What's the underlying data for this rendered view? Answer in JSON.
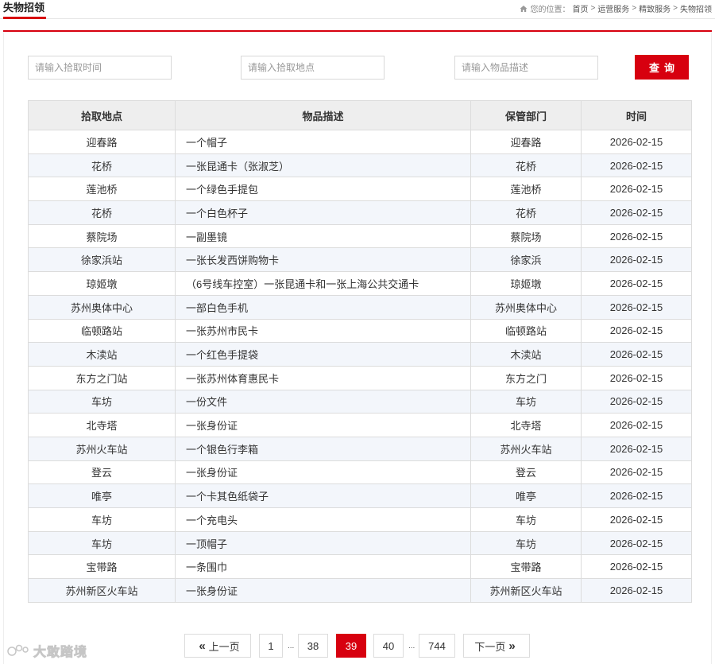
{
  "header": {
    "title": "失物招领",
    "breadcrumb": {
      "prefix": "您的位置：",
      "items": [
        "首页",
        "运营服务",
        "精致服务",
        "失物招领"
      ],
      "separator": ">"
    }
  },
  "search": {
    "time_placeholder": "请输入拾取时间",
    "location_placeholder": "请输入拾取地点",
    "desc_placeholder": "请输入物品描述",
    "button_label": "查询"
  },
  "table": {
    "headers": [
      "拾取地点",
      "物品描述",
      "保管部门",
      "时间"
    ],
    "rows": [
      [
        "迎春路",
        "一个帽子",
        "迎春路",
        "2026-02-15"
      ],
      [
        "花桥",
        "一张昆通卡（张淑芝）",
        "花桥",
        "2026-02-15"
      ],
      [
        "莲池桥",
        "一个绿色手提包",
        "莲池桥",
        "2026-02-15"
      ],
      [
        "花桥",
        "一个白色杯子",
        "花桥",
        "2026-02-15"
      ],
      [
        "蔡院场",
        "一副墨镜",
        "蔡院场",
        "2026-02-15"
      ],
      [
        "徐家浜站",
        "一张长发西饼购物卡",
        "徐家浜",
        "2026-02-15"
      ],
      [
        "琼姬墩",
        "（6号线车控室）一张昆通卡和一张上海公共交通卡",
        "琼姬墩",
        "2026-02-15"
      ],
      [
        "苏州奥体中心",
        "一部白色手机",
        "苏州奥体中心",
        "2026-02-15"
      ],
      [
        "临顿路站",
        "一张苏州市民卡",
        "临顿路站",
        "2026-02-15"
      ],
      [
        "木渎站",
        "一个红色手提袋",
        "木渎站",
        "2026-02-15"
      ],
      [
        "东方之门站",
        "一张苏州体育惠民卡",
        "东方之门",
        "2026-02-15"
      ],
      [
        "车坊",
        "一份文件",
        "车坊",
        "2026-02-15"
      ],
      [
        "北寺塔",
        "一张身份证",
        "北寺塔",
        "2026-02-15"
      ],
      [
        "苏州火车站",
        "一个银色行李箱",
        "苏州火车站",
        "2026-02-15"
      ],
      [
        "登云",
        "一张身份证",
        "登云",
        "2026-02-15"
      ],
      [
        "唯亭",
        "一个卡其色纸袋子",
        "唯亭",
        "2026-02-15"
      ],
      [
        "车坊",
        "一个充电头",
        "车坊",
        "2026-02-15"
      ],
      [
        "车坊",
        "一顶帽子",
        "车坊",
        "2026-02-15"
      ],
      [
        "宝带路",
        "一条围巾",
        "宝带路",
        "2026-02-15"
      ],
      [
        "苏州新区火车站",
        "一张身份证",
        "苏州新区火车站",
        "2026-02-15"
      ]
    ]
  },
  "pagination": {
    "prev_label": "上一页",
    "next_label": "下一页",
    "pages": [
      "1",
      "38",
      "39",
      "40",
      "744"
    ],
    "current": "39",
    "ellipsis": "..."
  },
  "watermark": {
    "text": "大敢踏境"
  },
  "colors": {
    "accent": "#d7000f",
    "header_bg": "#eeeeee",
    "row_alt": "#f3f6fb",
    "border": "#dcdcdc"
  },
  "icons": [
    "home-icon",
    "double-chevron-left-icon",
    "double-chevron-right-icon",
    "watermark-logo-icon"
  ]
}
